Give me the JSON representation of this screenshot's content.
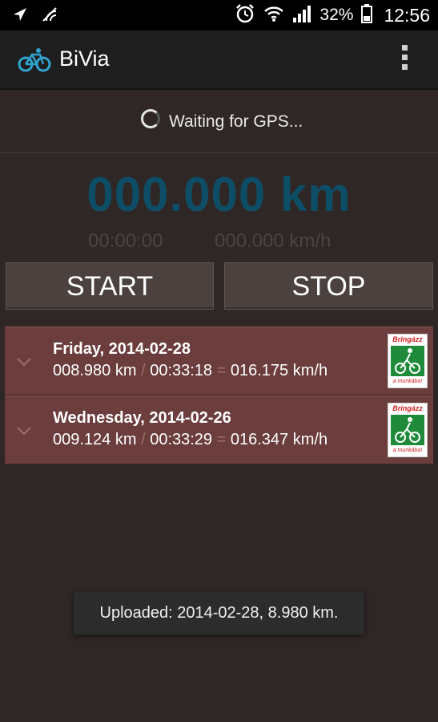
{
  "status_bar": {
    "battery_percent": "32%",
    "time": "12:56",
    "icons": [
      "location-icon",
      "signal-icon",
      "alarm-icon",
      "wifi-icon",
      "cell-signal-icon",
      "battery-icon"
    ]
  },
  "app_bar": {
    "title": "BiVia",
    "logo_icon": "bicycle-icon",
    "menu_icon": "overflow-menu-icon"
  },
  "gps": {
    "status": "Waiting for GPS..."
  },
  "tracker": {
    "distance": "000.000 km",
    "elapsed": "00:00:00",
    "speed": "000.000 km/h"
  },
  "controls": {
    "start_label": "START",
    "stop_label": "STOP"
  },
  "trips": [
    {
      "day": "Friday, 2014-02-28",
      "distance": "008.980 km",
      "duration": "00:33:18",
      "speed": "016.175 km/h",
      "badge_top": "Bringázz",
      "badge_bottom": "a munkába!"
    },
    {
      "day": "Wednesday, 2014-02-26",
      "distance": "009.124 km",
      "duration": "00:33:29",
      "speed": "016.347 km/h",
      "badge_top": "Bringázz",
      "badge_bottom": "a munkába!"
    }
  ],
  "separators": {
    "slash": "/",
    "equals": "="
  },
  "toast": {
    "message": "Uploaded: 2014-02-28, 8.980 km."
  },
  "colors": {
    "background": "#2f2725",
    "accent_distance": "#0d4e66",
    "trip_row": "#6b3d3c",
    "badge_green": "#1e8a3a"
  }
}
